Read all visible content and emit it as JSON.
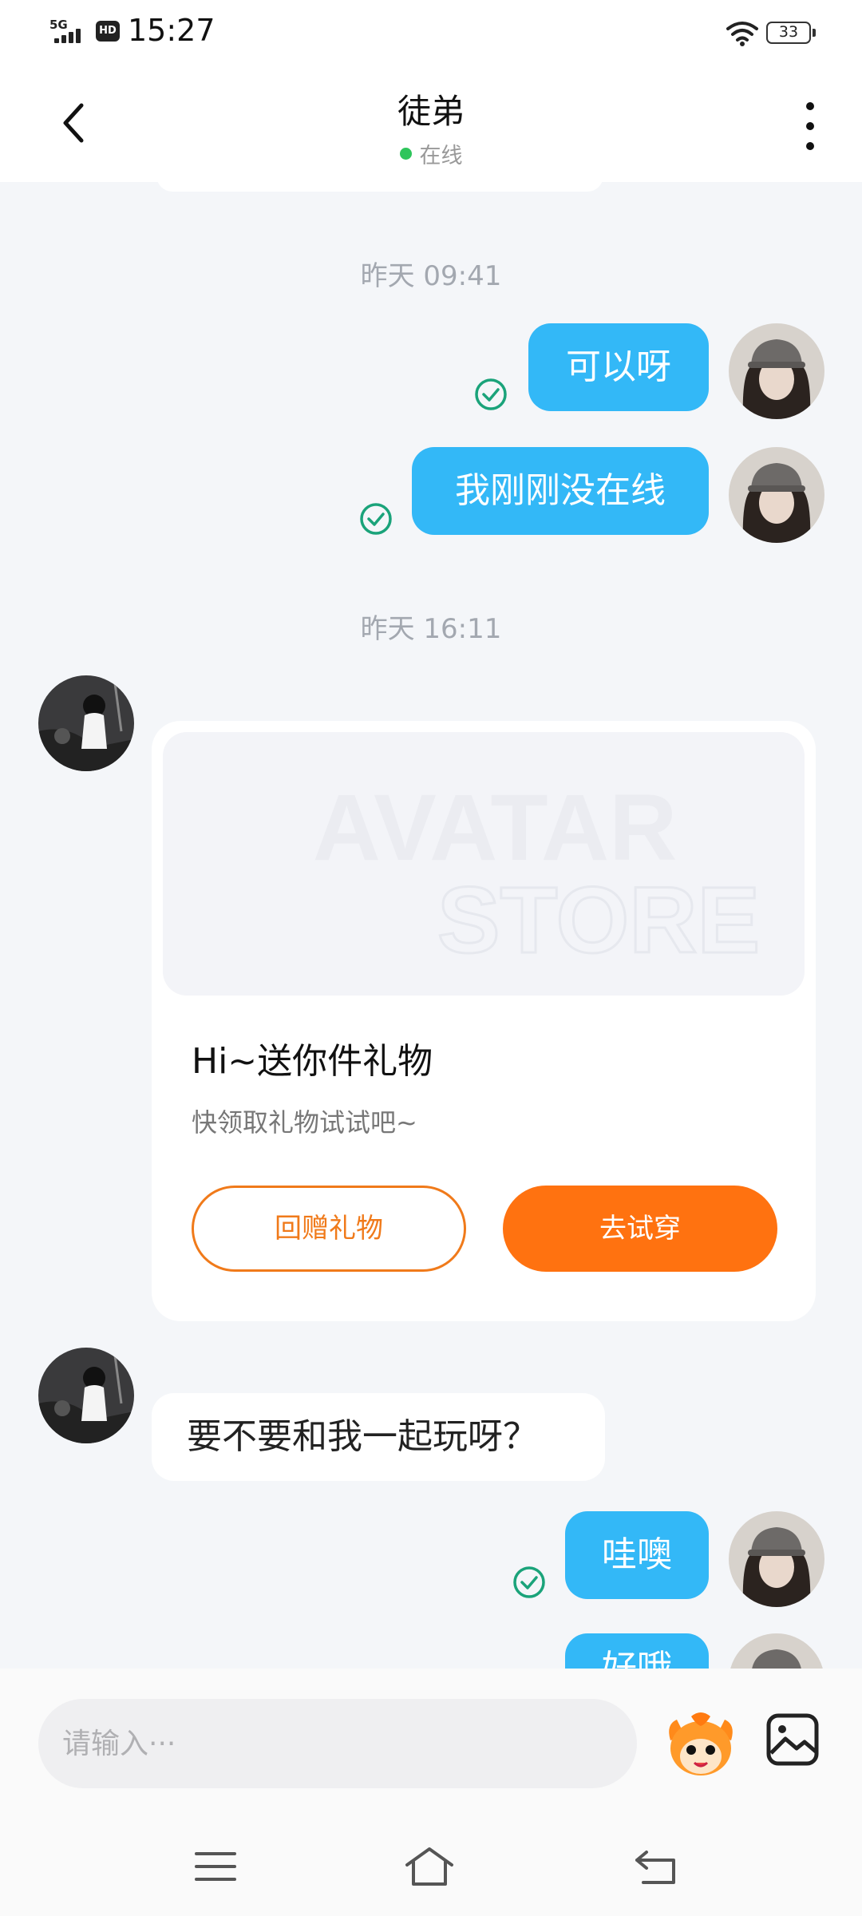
{
  "status_bar": {
    "network": "5G",
    "hd": "HD",
    "time": "15:27",
    "battery": "33",
    "icons": [
      "signal-icon",
      "hd-icon",
      "wifi-icon",
      "battery-icon"
    ]
  },
  "header": {
    "title": "徒弟",
    "status": "在线",
    "status_color": "#2ec55b",
    "icons": [
      "back-icon",
      "more-icon"
    ]
  },
  "messages": [
    {
      "type": "timestamp",
      "text": "昨天 09:41"
    },
    {
      "type": "sent",
      "text": "可以呀",
      "read": true
    },
    {
      "type": "sent",
      "text": "我刚刚没在线",
      "read": true
    },
    {
      "type": "timestamp",
      "text": "昨天 16:11"
    },
    {
      "type": "gift_card",
      "banner_text_1": "AVATAR",
      "banner_text_2": "STORE",
      "title": "Hi~送你件礼物",
      "subtitle": "快领取礼物试试吧~",
      "button_return": "回赠礼物",
      "button_try": "去试穿"
    },
    {
      "type": "received",
      "text": "要不要和我一起玩呀？"
    },
    {
      "type": "sent",
      "text": "哇噢",
      "read": true
    },
    {
      "type": "sent",
      "text": "好哦",
      "read": true,
      "partially_visible": true
    }
  ],
  "input": {
    "placeholder": "请输入···",
    "icons": [
      "emoji-mascot-icon",
      "image-icon"
    ]
  },
  "navigation": {
    "icons": [
      "menu-icon",
      "home-icon",
      "back-nav-icon"
    ]
  },
  "colors": {
    "sent_bubble": "#33b8f7",
    "accent_orange": "#ff7210",
    "background": "#f4f6f9",
    "read_check": "#1aa37a"
  }
}
